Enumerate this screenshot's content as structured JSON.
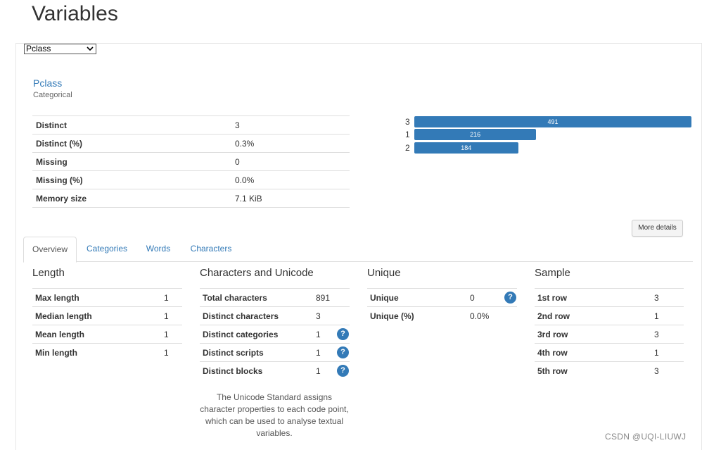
{
  "page": {
    "title": "Variables"
  },
  "selector": {
    "selected": "Pclass"
  },
  "variable": {
    "name": "Pclass",
    "type": "Categorical",
    "stats": [
      {
        "label": "Distinct",
        "value": "3"
      },
      {
        "label": "Distinct (%)",
        "value": "0.3%"
      },
      {
        "label": "Missing",
        "value": "0"
      },
      {
        "label": "Missing (%)",
        "value": "0.0%"
      },
      {
        "label": "Memory size",
        "value": "7.1 KiB"
      }
    ]
  },
  "chart_data": {
    "type": "bar",
    "orientation": "horizontal",
    "categories": [
      "3",
      "1",
      "2"
    ],
    "values": [
      491,
      216,
      184
    ],
    "title": "",
    "xlabel": "",
    "ylabel": "",
    "bar_color": "#337ab7"
  },
  "more_details_label": "More details",
  "tabs": [
    {
      "label": "Overview",
      "active": true
    },
    {
      "label": "Categories",
      "active": false
    },
    {
      "label": "Words",
      "active": false
    },
    {
      "label": "Characters",
      "active": false
    }
  ],
  "overview": {
    "length": {
      "title": "Length",
      "rows": [
        {
          "label": "Max length",
          "value": "1"
        },
        {
          "label": "Median length",
          "value": "1"
        },
        {
          "label": "Mean length",
          "value": "1"
        },
        {
          "label": "Min length",
          "value": "1"
        }
      ]
    },
    "unicode": {
      "title": "Characters and Unicode",
      "rows": [
        {
          "label": "Total characters",
          "value": "891",
          "help": false
        },
        {
          "label": "Distinct characters",
          "value": "3",
          "help": false
        },
        {
          "label": "Distinct categories",
          "value": "1",
          "help": true
        },
        {
          "label": "Distinct scripts",
          "value": "1",
          "help": true
        },
        {
          "label": "Distinct blocks",
          "value": "1",
          "help": true
        }
      ],
      "note": "The Unicode Standard assigns character properties to each code point, which can be used to analyse textual variables."
    },
    "unique": {
      "title": "Unique",
      "rows": [
        {
          "label": "Unique",
          "value": "0",
          "help": true
        },
        {
          "label": "Unique (%)",
          "value": "0.0%",
          "help": false
        }
      ]
    },
    "sample": {
      "title": "Sample",
      "rows": [
        {
          "label": "1st row",
          "value": "3"
        },
        {
          "label": "2nd row",
          "value": "1"
        },
        {
          "label": "3rd row",
          "value": "3"
        },
        {
          "label": "4th row",
          "value": "1"
        },
        {
          "label": "5th row",
          "value": "3"
        }
      ]
    }
  },
  "help_glyph": "?",
  "watermark": "CSDN @UQI-LIUWJ"
}
